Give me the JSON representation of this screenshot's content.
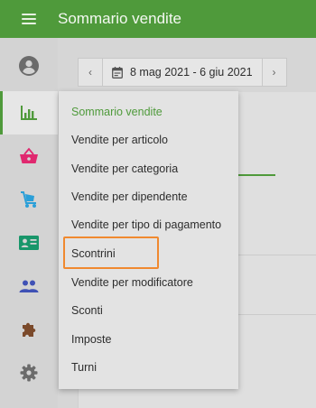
{
  "header": {
    "title": "Sommario vendite",
    "menu_icon": "hamburger-icon"
  },
  "sidebar": {
    "items": [
      {
        "name": "account",
        "icon": "account-circle-icon",
        "color": "#6b6b6b"
      },
      {
        "name": "reports",
        "icon": "bar-chart-icon",
        "color": "#4f9a3b",
        "active": true
      },
      {
        "name": "items",
        "icon": "basket-icon",
        "color": "#e0286f"
      },
      {
        "name": "employees",
        "icon": "employee-cart-icon",
        "color": "#2a9fd8"
      },
      {
        "name": "customers",
        "icon": "id-card-icon",
        "color": "#18966a"
      },
      {
        "name": "users",
        "icon": "users-icon",
        "color": "#3f51b5"
      },
      {
        "name": "integrations",
        "icon": "puzzle-icon",
        "color": "#7b4a2b"
      },
      {
        "name": "settings",
        "icon": "gear-icon",
        "color": "#6b6b6b"
      }
    ]
  },
  "date_range": {
    "label": "8 mag 2021 - 6 giu 2021",
    "prev": "‹",
    "next": "›"
  },
  "menu": {
    "items": [
      {
        "label": "Sommario vendite",
        "selected": true
      },
      {
        "label": "Vendite per articolo"
      },
      {
        "label": "Vendite per categoria"
      },
      {
        "label": "Vendite per dipendente"
      },
      {
        "label": "Vendite per tipo di pagamento"
      },
      {
        "label": "Scontrini",
        "highlighted": true
      },
      {
        "label": "Vendite per modificatore"
      },
      {
        "label": "Sconti"
      },
      {
        "label": "Imposte"
      },
      {
        "label": "Turni"
      }
    ]
  },
  "colors": {
    "accent": "#4f9a3b",
    "highlight": "#f0892f"
  }
}
